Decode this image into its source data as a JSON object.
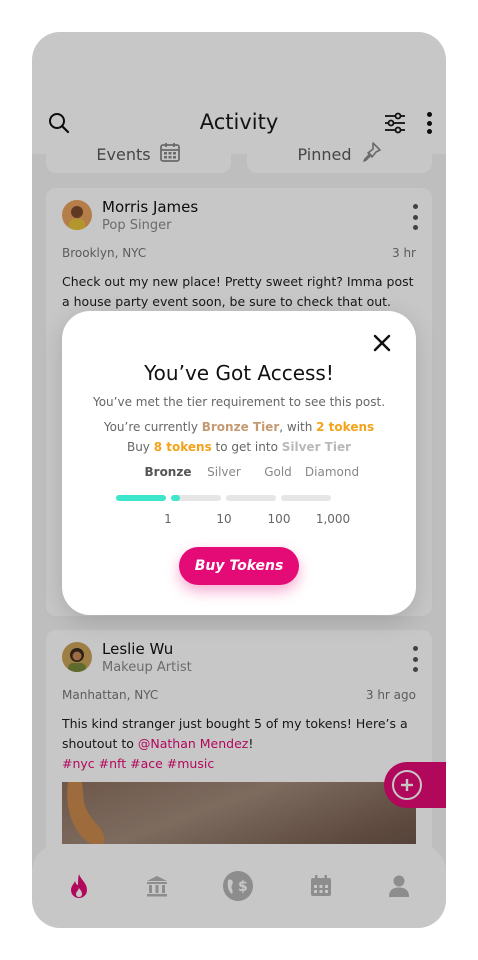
{
  "header": {
    "title": "Activity"
  },
  "tabs": [
    {
      "label": "Events",
      "icon": "calendar-icon"
    },
    {
      "label": "Pinned",
      "icon": "pin-icon"
    }
  ],
  "posts": [
    {
      "author": "Morris James",
      "role": "Pop Singer",
      "location": "Brooklyn, NYC",
      "time": "3 hr",
      "text": "Check out my new place! Pretty sweet right? Imma post a house party event soon, be sure to check that out."
    },
    {
      "author": "Leslie Wu",
      "role": "Makeup Artist",
      "location": "Manhattan, NYC",
      "time": "3 hr ago",
      "text_before": "This kind stranger just bought 5 of my tokens! Here’s a shoutout to ",
      "mention": "@Nathan Mendez",
      "text_after": "!",
      "tags": "#nyc #nft #ace #music"
    }
  ],
  "modal": {
    "title": "You’ve Got Access!",
    "description": "You’ve met the tier requirement to see this post.",
    "current_prefix": "You’re currently ",
    "current_tier": "Bronze Tier",
    "current_mid": ", with ",
    "current_tokens": "2 tokens",
    "buy_prefix": "Buy ",
    "buy_tokens": "8 tokens",
    "buy_mid": " to get into ",
    "next_tier": "Silver Tier",
    "tiers": [
      {
        "name": "Bronze",
        "threshold": "1",
        "progress": 1.0
      },
      {
        "name": "Silver",
        "threshold": "10",
        "progress": 0.11
      },
      {
        "name": "Gold",
        "threshold": "100",
        "progress": 0
      },
      {
        "name": "Diamond",
        "threshold": "1,000",
        "progress": 0
      }
    ],
    "button_label": "Buy Tokens"
  },
  "colors": {
    "accent": "#e40b77",
    "progress": "#3ee6cc",
    "bronze": "#c59a72",
    "orange": "#f4a21a",
    "silver": "#b9b9b9"
  },
  "bottom_nav": [
    "flame-icon",
    "bank-icon",
    "globe-dollar-icon",
    "calendar-icon",
    "user-icon"
  ]
}
